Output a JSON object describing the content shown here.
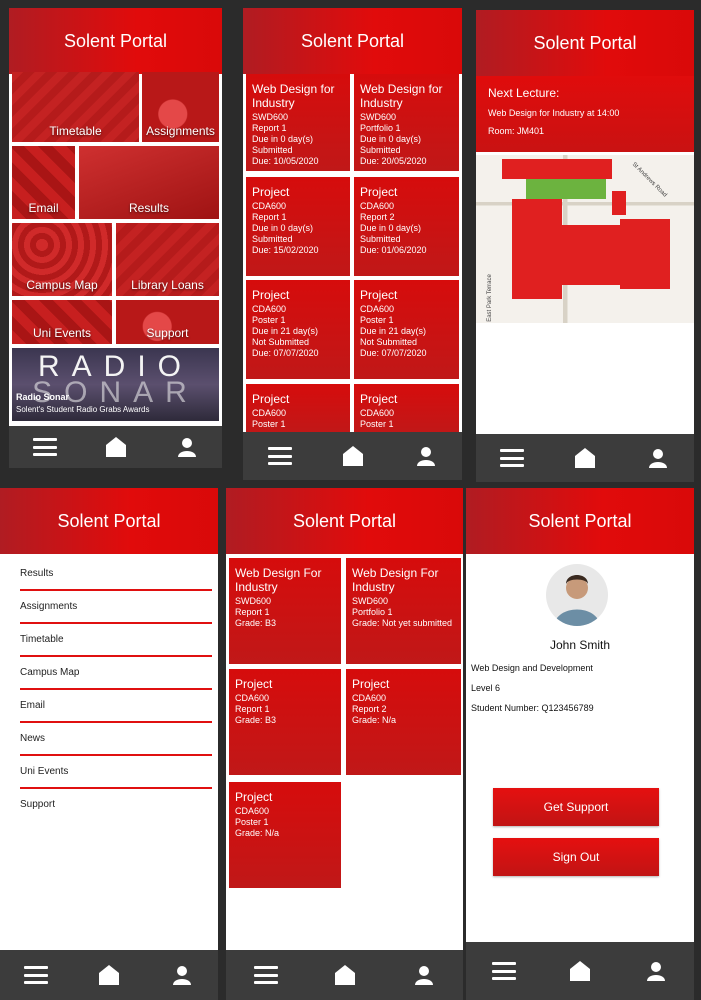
{
  "app_title": "Solent Portal",
  "home": {
    "tiles": [
      "Timetable",
      "Assignments",
      "Email",
      "Results",
      "Campus Map",
      "Library Loans",
      "Uni Events",
      "Support"
    ],
    "radio": {
      "logo_text": "RADIO SONAR",
      "headline": "Radio Sonar",
      "subline": "Solent's Student Radio Grabs Awards"
    }
  },
  "assignments": [
    {
      "title": "Web Design for Industry",
      "code": "SWD600",
      "item": "Report 1",
      "due_in": "Due in 0 day(s)",
      "status": "Submitted",
      "due": "Due: 10/05/2020"
    },
    {
      "title": "Web Design for Industry",
      "code": "SWD600",
      "item": "Portfolio 1",
      "due_in": "Due in 0 day(s)",
      "status": "Submitted",
      "due": "Due: 20/05/2020"
    },
    {
      "title": "Project",
      "code": "CDA600",
      "item": "Report 1",
      "due_in": "Due in 0 day(s)",
      "status": "Submitted",
      "due": "Due: 15/02/2020"
    },
    {
      "title": "Project",
      "code": "CDA600",
      "item": "Report 2",
      "due_in": "Due in 0 day(s)",
      "status": "Submitted",
      "due": "Due: 01/06/2020"
    },
    {
      "title": "Project",
      "code": "CDA600",
      "item": "Poster 1",
      "due_in": "Due in 21 day(s)",
      "status": "Not Submitted",
      "due": "Due: 07/07/2020"
    },
    {
      "title": "Project",
      "code": "CDA600",
      "item": "Poster 1",
      "due_in": "Due in 21 day(s)",
      "status": "Not Submitted",
      "due": "Due: 07/07/2020"
    },
    {
      "title": "Project",
      "code": "CDA600",
      "item": "Poster 1"
    },
    {
      "title": "Project",
      "code": "CDA600",
      "item": "Poster 1"
    }
  ],
  "timetable": {
    "heading": "Next Lecture:",
    "lecture": "Web Design for Industry at 14:00",
    "room": "Room: JM401",
    "map_label_road": "St Andrews Road",
    "map_label_terrace": "East Park Terrace"
  },
  "menu": [
    "Results",
    "Assignments",
    "Timetable",
    "Campus Map",
    "Email",
    "News",
    "Uni Events",
    "Support"
  ],
  "results": [
    {
      "title": "Web Design For Industry",
      "code": "SWD600",
      "item": "Report 1",
      "grade": "Grade: B3"
    },
    {
      "title": "Web Design For Industry",
      "code": "SWD600",
      "item": "Portfolio 1",
      "grade": "Grade: Not yet submitted"
    },
    {
      "title": "Project",
      "code": "CDA600",
      "item": "Report 1",
      "grade": "Grade: B3"
    },
    {
      "title": "Project",
      "code": "CDA600",
      "item": "Report 2",
      "grade": "Grade: N/a"
    },
    {
      "title": "Project",
      "code": "CDA600",
      "item": "Poster 1",
      "grade": "Grade: N/a"
    }
  ],
  "profile": {
    "name": "John Smith",
    "course": "Web Design and Development",
    "level": "Level 6",
    "student_number": "Student Number: Q123456789",
    "support_btn": "Get Support",
    "signout_btn": "Sign Out"
  },
  "icons": [
    "menu-icon",
    "home-icon",
    "user-icon"
  ],
  "colors": {
    "accent": "#e10b0b",
    "nav": "#3c3c3c"
  }
}
